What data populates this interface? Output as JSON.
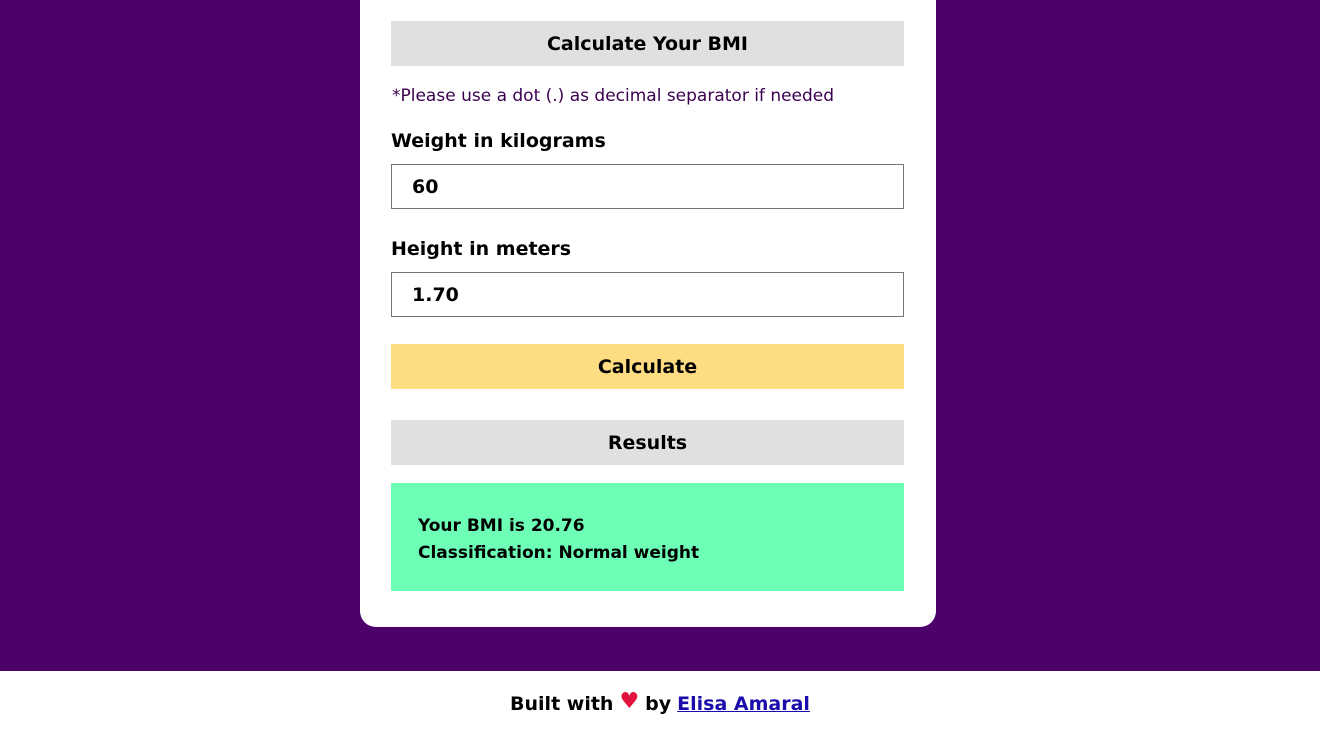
{
  "form": {
    "title": "Calculate Your BMI",
    "note": "*Please use a dot (.) as decimal separator if needed",
    "weight_label": "Weight in kilograms",
    "weight_value": "60",
    "height_label": "Height in meters",
    "height_value": "1.70",
    "calculate_label": "Calculate"
  },
  "results": {
    "title": "Results",
    "bmi_text": "Your BMI is 20.76",
    "classification_text": "Classification: Normal weight"
  },
  "footer": {
    "built_with": "Built with",
    "heart": "♥",
    "by": "by",
    "author": "Elisa Amaral"
  },
  "colors": {
    "background": "#4b006a",
    "calculate_button": "#fddc82",
    "result_box": "#6dffb6",
    "header_bar": "#e0e0e0",
    "heart": "#e0143c"
  },
  "icons": {
    "heart": "heart-icon"
  }
}
